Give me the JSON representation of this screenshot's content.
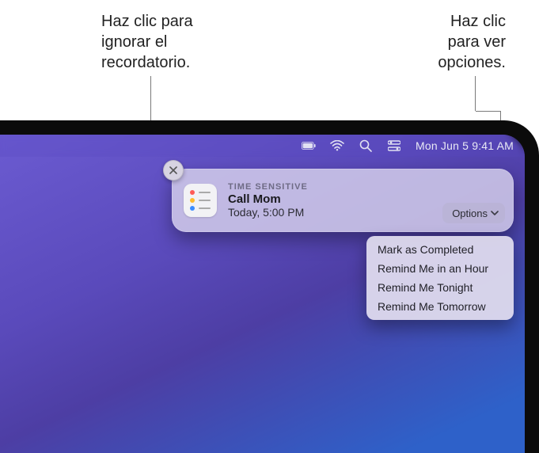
{
  "callouts": {
    "dismiss": "Haz clic para\nignorar el\nrecordatorio.",
    "options": "Haz clic\npara ver\nopciones."
  },
  "menubar": {
    "datetime": "Mon Jun 5  9:41 AM"
  },
  "notification": {
    "badge": "TIME SENSITIVE",
    "title": "Call Mom",
    "subtitle": "Today, 5:00 PM",
    "options_label": "Options",
    "app_icon_dots": [
      "#ff5b57",
      "#ffbb2e",
      "#3b8cff"
    ]
  },
  "dropdown": {
    "items": [
      "Mark as Completed",
      "Remind Me in an Hour",
      "Remind Me Tonight",
      "Remind Me Tomorrow"
    ]
  }
}
